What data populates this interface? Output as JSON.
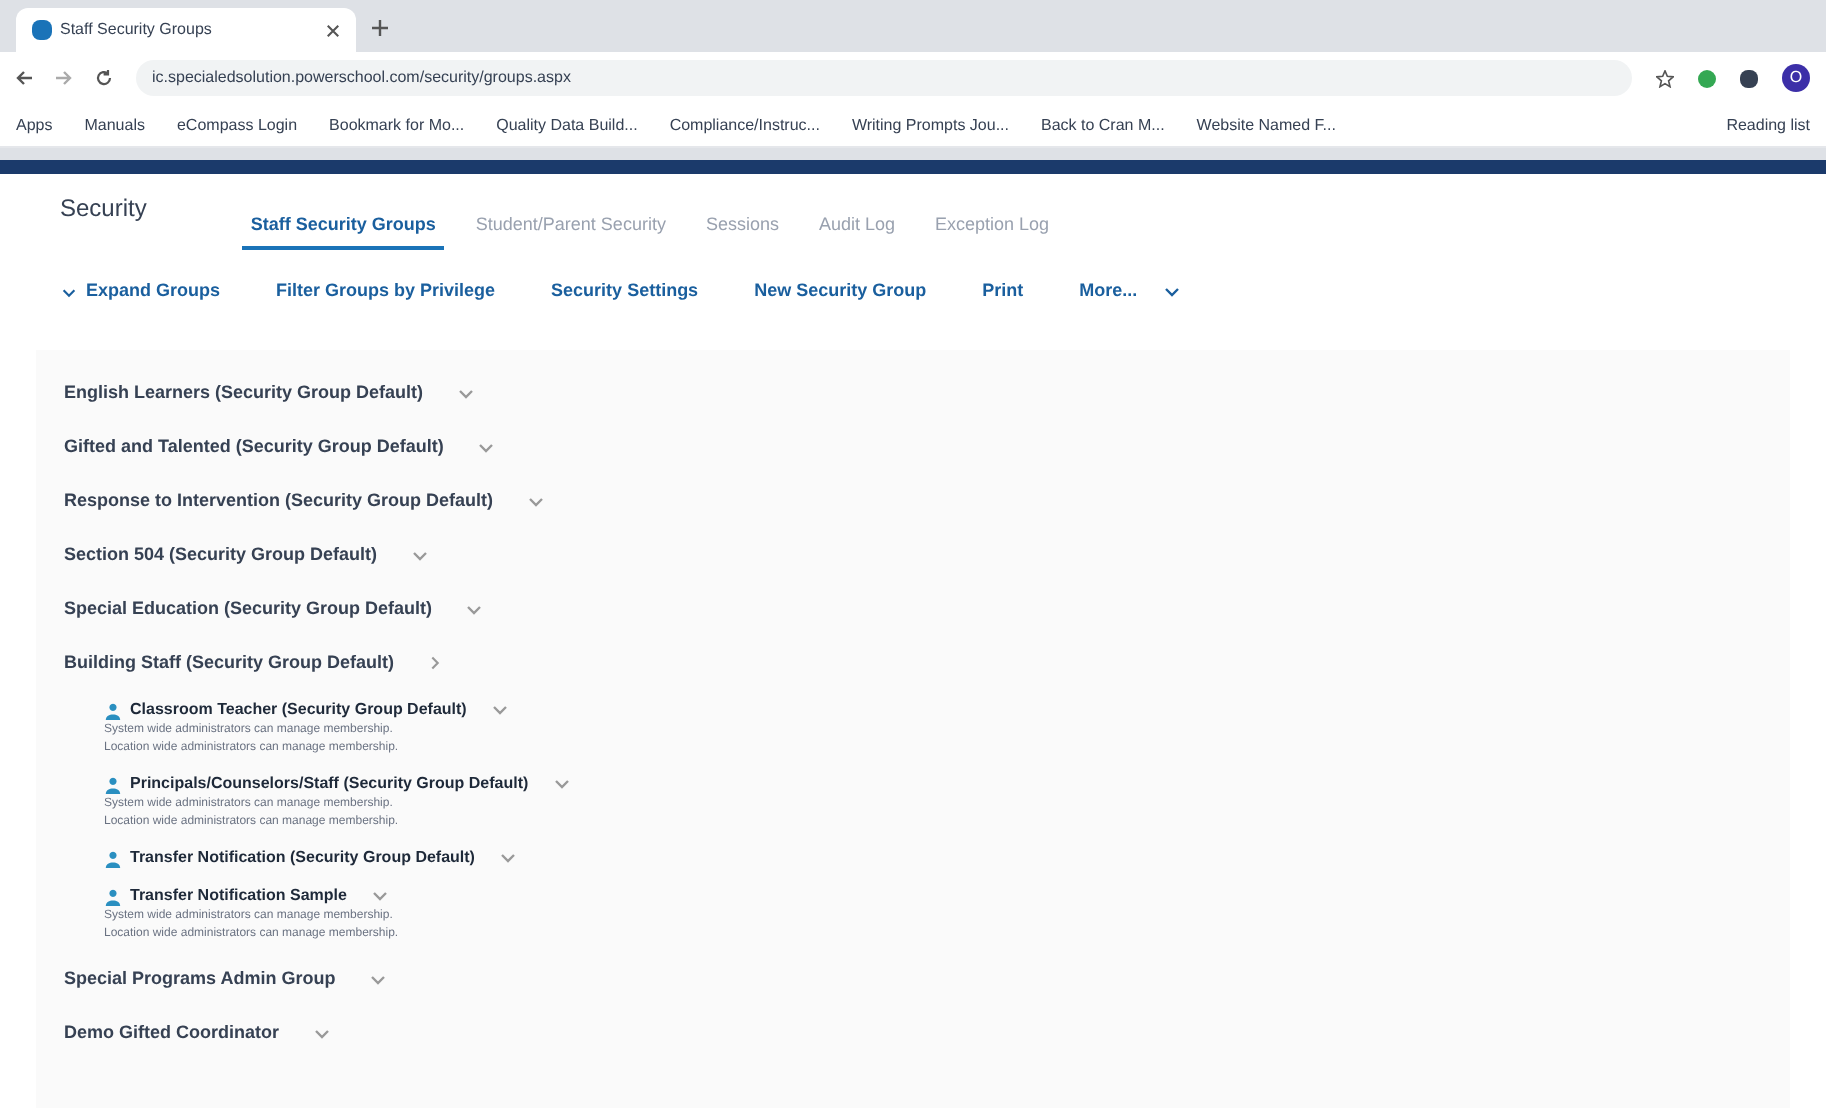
{
  "browser": {
    "tab_title": "Staff Security Groups",
    "url": "ic.specialedsolution.powerschool.com/security/groups.aspx",
    "bookmarks": [
      "Apps",
      "Manuals",
      "eCompass Login",
      "Bookmark for Mo...",
      "Quality Data Build...",
      "Compliance/Instruc...",
      "Writing Prompts Jou...",
      "Back to Cran M...",
      "Website Named F..."
    ],
    "reading_list": "Reading list",
    "profile_initial": "O"
  },
  "page": {
    "title": "Security"
  },
  "tabs": [
    {
      "label": "Staff Security Groups",
      "selected": true
    },
    {
      "label": "Student/Parent Security",
      "selected": false
    },
    {
      "label": "Sessions",
      "selected": false
    },
    {
      "label": "Audit Log",
      "selected": false
    },
    {
      "label": "Exception Log",
      "selected": false
    }
  ],
  "toolbar": [
    "Expand Groups",
    "Filter Groups by Privilege",
    "Security Settings",
    "New Security Group",
    "Print",
    "More..."
  ],
  "groups": [
    {
      "name": "English Learners (Security Group Default)",
      "expanded": false
    },
    {
      "name": "Gifted and Talented (Security Group Default)",
      "expanded": false
    },
    {
      "name": "Response to Intervention (Security Group Default)",
      "expanded": false
    },
    {
      "name": "Section 504 (Security Group Default)",
      "expanded": false
    },
    {
      "name": "Special Education (Security Group Default)",
      "expanded": false
    },
    {
      "name": "Building Staff (Security Group Default)",
      "expanded": true,
      "children": [
        {
          "name": "Classroom Teacher (Security Group Default)",
          "notes": [
            "System wide administrators can manage membership.",
            "Location wide administrators can manage membership."
          ]
        },
        {
          "name": "Principals/Counselors/Staff (Security Group Default)",
          "notes": [
            "System wide administrators can manage membership.",
            "Location wide administrators can manage membership."
          ]
        },
        {
          "name": "Transfer Notification (Security Group Default)"
        },
        {
          "name": "Transfer Notification Sample",
          "notes": [
            "System wide administrators can manage membership.",
            "Location wide administrators can manage membership."
          ]
        }
      ]
    },
    {
      "name": "Special Programs Admin Group",
      "expanded": false
    },
    {
      "name": "Demo Gifted Coordinator",
      "expanded": false
    }
  ]
}
